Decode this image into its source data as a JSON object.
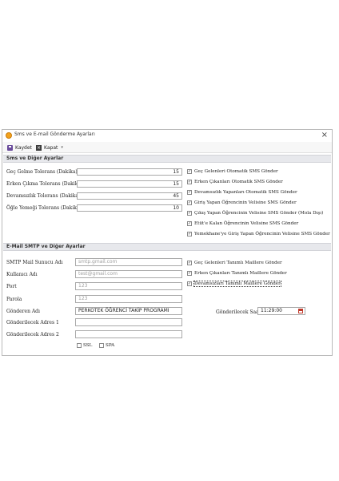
{
  "window": {
    "title": "Sms ve E-mail Gönderme Ayarları"
  },
  "toolbar": {
    "save_label": "Kaydet",
    "close_label": "Kapat"
  },
  "sms_group": {
    "header": "Sms ve Diğer Ayarlar",
    "fields": [
      {
        "label": "Geç Gelme Tolerans (Dakika)",
        "value": "15"
      },
      {
        "label": "Erken Çıkma Tolerans (Dakika)",
        "value": "15"
      },
      {
        "label": "Devamsızlık Tolerans (Dakika)",
        "value": "45"
      },
      {
        "label": "Öğle Yemeği Tolerans (Dakika)",
        "value": "10"
      }
    ],
    "checkboxes": [
      {
        "label": "Geç Gelenleri Otomatik SMS Gönder",
        "checked": true
      },
      {
        "label": "Erken Çıkanları Otomatik SMS Gönder",
        "checked": true
      },
      {
        "label": "Devamsızlık Yapanları Otomatik SMS Gönder",
        "checked": true
      },
      {
        "label": "Giriş Yapan Öğrencinin Velisine SMS Gönder",
        "checked": true
      },
      {
        "label": "Çıkış Yapan Öğrencinin Velisine SMS Gönder (Mola Dışı)",
        "checked": true
      },
      {
        "label": "Etüt'e Kalan Öğrencinin Velisine SMS Gönder",
        "checked": true
      },
      {
        "label": "Yemekhane'ye Giriş Yapan Öğrencinin Velisine SMS Gönder",
        "checked": true
      }
    ]
  },
  "email_group": {
    "header": "E-Mail SMTP ve Diğer Ayarlar",
    "smtp_server": {
      "label": "SMTP Mail Sunucu Adı",
      "placeholder": "smtp.gmail.com"
    },
    "username": {
      "label": "Kullanıcı Adı",
      "placeholder": "test@gmail.com"
    },
    "port": {
      "label": "Port",
      "placeholder": "123"
    },
    "password": {
      "label": "Parola",
      "placeholder": "123"
    },
    "sender_name": {
      "label": "Gönderen Adı",
      "value": "PERKOTEK ÖĞRENCİ TAKİP PROGRAMI"
    },
    "address1": {
      "label": "Gönderilecek Adres 1",
      "value": ""
    },
    "address2": {
      "label": "Gönderilecek Adres 2",
      "value": ""
    },
    "ssl_label": "SSL",
    "spa_label": "SPA",
    "checkboxes": [
      {
        "label": "Geç Gelenleri Tanımlı Maillere Gönder",
        "checked": true
      },
      {
        "label": "Erken Çıkanları Tanımlı Maillere Gönder",
        "checked": true
      },
      {
        "label": "Devamsızları Tanımlı Maillere Gönder",
        "checked": true
      }
    ],
    "send_time": {
      "label": "Gönderilecek Saat",
      "value": "11:29:00"
    }
  }
}
